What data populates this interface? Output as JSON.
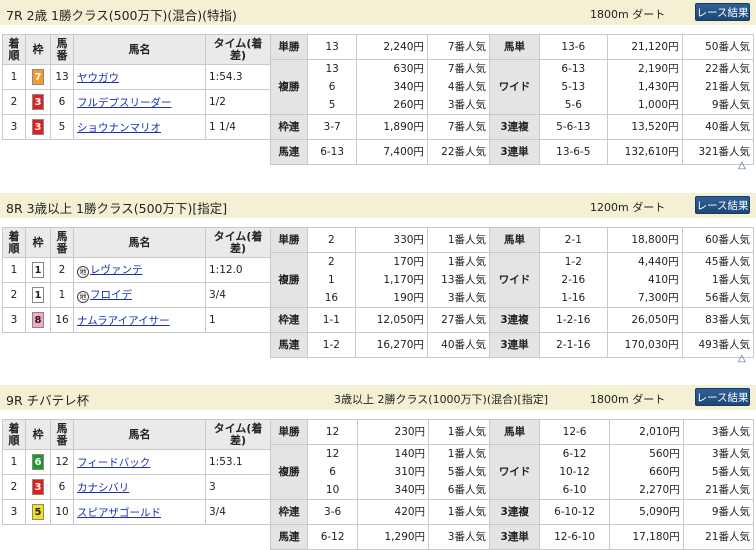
{
  "races": [
    {
      "title": "7R 2歳 1勝クラス(500万下)(混合)(特指)",
      "conditions": "",
      "distance": "1800m ダート",
      "button": "レース結果",
      "headers": [
        "着順",
        "枠",
        "馬番",
        "馬名",
        "タイム(着差)"
      ],
      "results": [
        {
          "rank": "1",
          "waku": "7",
          "waku_bg": "#f39c2b",
          "waku_fg": "#ffffff",
          "umaban": "13",
          "name": "ヤウガウ",
          "mark": "",
          "time": "1:54.3"
        },
        {
          "rank": "2",
          "waku": "3",
          "waku_bg": "#e02020",
          "waku_fg": "#ffffff",
          "umaban": "6",
          "name": "フルデプスリーダー",
          "mark": "",
          "time": "1/2"
        },
        {
          "rank": "3",
          "waku": "3",
          "waku_bg": "#e02020",
          "waku_fg": "#ffffff",
          "umaban": "5",
          "name": "ショウナンマリオ",
          "mark": "",
          "time": "1 1/4"
        }
      ],
      "payouts": [
        {
          "label": "単勝",
          "combos": [
            "13"
          ],
          "amounts": [
            "2,240円"
          ],
          "pops": [
            "7番人気"
          ],
          "label2": "馬単",
          "combos2": [
            "13-6"
          ],
          "amounts2": [
            "21,120円"
          ],
          "pops2": [
            "50番人気"
          ]
        },
        {
          "label": "複勝",
          "combos": [
            "13",
            "6",
            "5"
          ],
          "amounts": [
            "630円",
            "340円",
            "260円"
          ],
          "pops": [
            "7番人気",
            "4番人気",
            "3番人気"
          ],
          "label2": "ワイド",
          "combos2": [
            "6-13",
            "5-13",
            "5-6"
          ],
          "amounts2": [
            "2,190円",
            "1,430円",
            "1,000円"
          ],
          "pops2": [
            "22番人気",
            "21番人気",
            "9番人気"
          ]
        },
        {
          "label": "枠連",
          "combos": [
            "3-7"
          ],
          "amounts": [
            "1,890円"
          ],
          "pops": [
            "7番人気"
          ],
          "label2": "3連複",
          "combos2": [
            "5-6-13"
          ],
          "amounts2": [
            "13,520円"
          ],
          "pops2": [
            "40番人気"
          ]
        },
        {
          "label": "馬連",
          "combos": [
            "6-13"
          ],
          "amounts": [
            "7,400円"
          ],
          "pops": [
            "22番人気"
          ],
          "label2": "3連単",
          "combos2": [
            "13-6-5"
          ],
          "amounts2": [
            "132,610円"
          ],
          "pops2": [
            "321番人気"
          ]
        }
      ]
    },
    {
      "title": "8R 3歳以上 1勝クラス(500万下)[指定]",
      "conditions": "",
      "distance": "1200m ダート",
      "button": "レース結果",
      "headers": [
        "着順",
        "枠",
        "馬番",
        "馬名",
        "タイム(着差)"
      ],
      "results": [
        {
          "rank": "1",
          "waku": "1",
          "waku_bg": "#ffffff",
          "waku_fg": "#222222",
          "umaban": "2",
          "name": "レヴァンテ",
          "mark": "地",
          "time": "1:12.0"
        },
        {
          "rank": "2",
          "waku": "1",
          "waku_bg": "#ffffff",
          "waku_fg": "#222222",
          "umaban": "1",
          "name": "フロイデ",
          "mark": "地",
          "time": "3/4"
        },
        {
          "rank": "3",
          "waku": "8",
          "waku_bg": "#f5a6c0",
          "waku_fg": "#222222",
          "umaban": "16",
          "name": "ナムラアイアイサー",
          "mark": "",
          "time": "1"
        }
      ],
      "payouts": [
        {
          "label": "単勝",
          "combos": [
            "2"
          ],
          "amounts": [
            "330円"
          ],
          "pops": [
            "1番人気"
          ],
          "label2": "馬単",
          "combos2": [
            "2-1"
          ],
          "amounts2": [
            "18,800円"
          ],
          "pops2": [
            "60番人気"
          ]
        },
        {
          "label": "複勝",
          "combos": [
            "2",
            "1",
            "16"
          ],
          "amounts": [
            "170円",
            "1,170円",
            "190円"
          ],
          "pops": [
            "1番人気",
            "13番人気",
            "3番人気"
          ],
          "label2": "ワイド",
          "combos2": [
            "1-2",
            "2-16",
            "1-16"
          ],
          "amounts2": [
            "4,440円",
            "410円",
            "7,300円"
          ],
          "pops2": [
            "45番人気",
            "1番人気",
            "56番人気"
          ]
        },
        {
          "label": "枠連",
          "combos": [
            "1-1"
          ],
          "amounts": [
            "12,050円"
          ],
          "pops": [
            "27番人気"
          ],
          "label2": "3連複",
          "combos2": [
            "1-2-16"
          ],
          "amounts2": [
            "26,050円"
          ],
          "pops2": [
            "83番人気"
          ]
        },
        {
          "label": "馬連",
          "combos": [
            "1-2"
          ],
          "amounts": [
            "16,270円"
          ],
          "pops": [
            "40番人気"
          ],
          "label2": "3連単",
          "combos2": [
            "2-1-16"
          ],
          "amounts2": [
            "170,030円"
          ],
          "pops2": [
            "493番人気"
          ]
        }
      ]
    },
    {
      "title": "9R チバテレ杯",
      "conditions": "3歳以上 2勝クラス(1000万下)(混合)[指定]",
      "distance": "1800m ダート",
      "button": "レース結果",
      "headers": [
        "着順",
        "枠",
        "馬番",
        "馬名",
        "タイム(着差)"
      ],
      "results": [
        {
          "rank": "1",
          "waku": "6",
          "waku_bg": "#1e9a2a",
          "waku_fg": "#ffffff",
          "umaban": "12",
          "name": "フィードバック",
          "mark": "",
          "time": "1:53.1"
        },
        {
          "rank": "2",
          "waku": "3",
          "waku_bg": "#e02020",
          "waku_fg": "#ffffff",
          "umaban": "6",
          "name": "カナシバリ",
          "mark": "",
          "time": "3"
        },
        {
          "rank": "3",
          "waku": "5",
          "waku_bg": "#f2e21a",
          "waku_fg": "#222222",
          "umaban": "10",
          "name": "スピアザゴールド",
          "mark": "",
          "time": "3/4"
        }
      ],
      "payouts": [
        {
          "label": "単勝",
          "combos": [
            "12"
          ],
          "amounts": [
            "230円"
          ],
          "pops": [
            "1番人気"
          ],
          "label2": "馬単",
          "combos2": [
            "12-6"
          ],
          "amounts2": [
            "2,010円"
          ],
          "pops2": [
            "3番人気"
          ]
        },
        {
          "label": "複勝",
          "combos": [
            "12",
            "6",
            "10"
          ],
          "amounts": [
            "140円",
            "310円",
            "340円"
          ],
          "pops": [
            "1番人気",
            "5番人気",
            "6番人気"
          ],
          "label2": "ワイド",
          "combos2": [
            "6-12",
            "10-12",
            "6-10"
          ],
          "amounts2": [
            "560円",
            "660円",
            "2,270円"
          ],
          "pops2": [
            "3番人気",
            "5番人気",
            "21番人気"
          ]
        },
        {
          "label": "枠連",
          "combos": [
            "3-6"
          ],
          "amounts": [
            "420円"
          ],
          "pops": [
            "1番人気"
          ],
          "label2": "3連複",
          "combos2": [
            "6-10-12"
          ],
          "amounts2": [
            "5,090円"
          ],
          "pops2": [
            "9番人気"
          ]
        },
        {
          "label": "馬連",
          "combos": [
            "6-12"
          ],
          "amounts": [
            "1,290円"
          ],
          "pops": [
            "3番人気"
          ],
          "label2": "3連単",
          "combos2": [
            "12-6-10"
          ],
          "amounts2": [
            "17,180円"
          ],
          "pops2": [
            "21番人気"
          ]
        }
      ]
    }
  ],
  "page_top": "△"
}
